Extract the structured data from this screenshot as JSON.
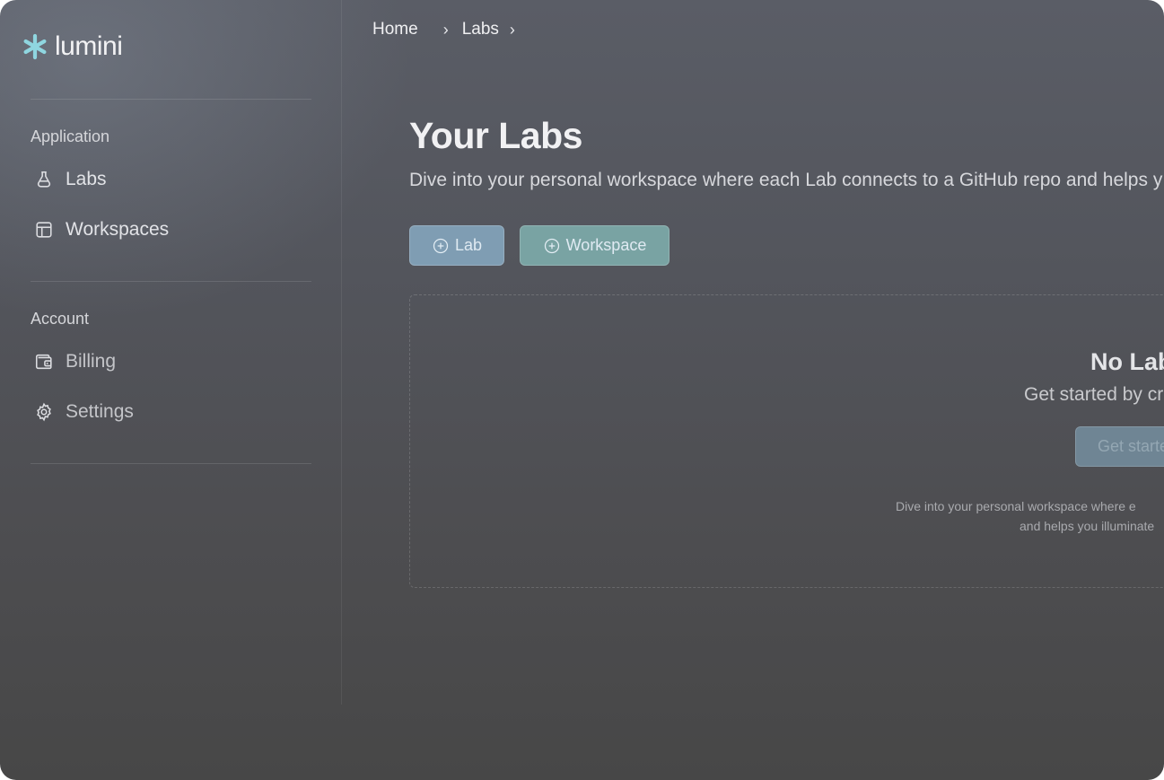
{
  "app": {
    "name": "lumini",
    "accent": "#8fd6e0"
  },
  "sidebar": {
    "sections": [
      {
        "label": "Application",
        "items": [
          {
            "label": "Labs",
            "icon": "flask-icon"
          },
          {
            "label": "Workspaces",
            "icon": "layout-icon"
          }
        ]
      },
      {
        "label": "Account",
        "items": [
          {
            "label": "Billing",
            "icon": "wallet-icon"
          },
          {
            "label": "Settings",
            "icon": "gear-icon"
          }
        ]
      }
    ]
  },
  "breadcrumb": {
    "items": [
      "Home",
      "Labs"
    ]
  },
  "main": {
    "title": "Your Labs",
    "description": "Dive into your personal workspace where each Lab connects to a GitHub repo and helps y",
    "buttons": {
      "lab": "Lab",
      "workspace": "Workspace"
    },
    "empty_state": {
      "title": "No Lab",
      "subtitle": "Get started by cr",
      "cta": "Get starte",
      "note_line1": "Dive into your personal workspace where e",
      "note_line2": "and helps you illuminate"
    }
  },
  "colors": {
    "lab_button": "#7f9db3",
    "workspace_button": "#79a3a3"
  }
}
